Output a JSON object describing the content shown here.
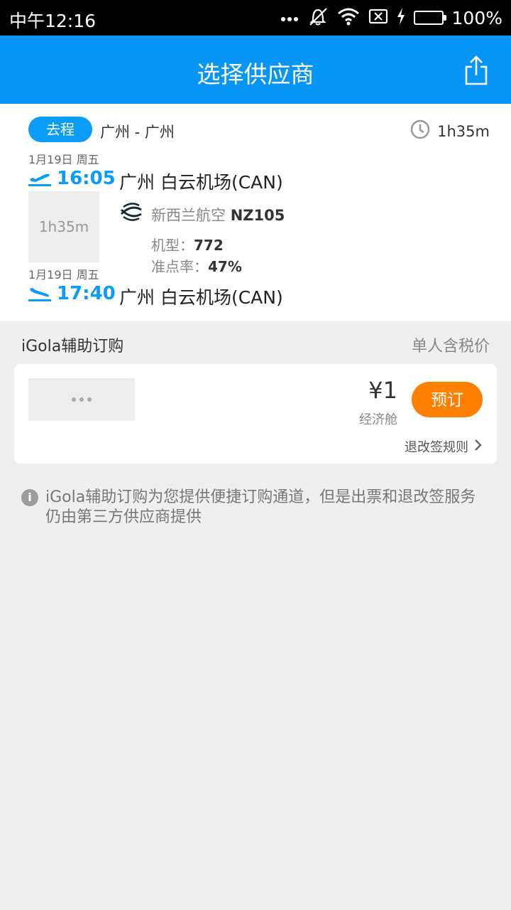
{
  "status_bar": {
    "time": "中午12:16",
    "battery_percent": "100%",
    "battery_level": 1.0,
    "icons": [
      "more-dots-icon",
      "vibrate-off-icon",
      "wifi-icon",
      "no-sim-icon",
      "charging-icon",
      "battery-icon"
    ]
  },
  "header": {
    "title": "选择供应商",
    "share_icon": "share-icon"
  },
  "flight": {
    "direction_tag": "去程",
    "route": "广州 - 广州",
    "total_duration": "1h35m",
    "departure": {
      "date": "1月19日 周五",
      "time": "16:05",
      "airport": "广州 白云机场(CAN)"
    },
    "segment_duration": "1h35m",
    "airline": {
      "name": "新西兰航空",
      "flight_no": "NZ105",
      "aircraft_label": "机型：",
      "aircraft": "772",
      "ontime_label": "准点率：",
      "ontime": "47%"
    },
    "arrival": {
      "date": "1月19日 周五",
      "time": "17:40",
      "airport": "广州 白云机场(CAN)"
    }
  },
  "supplier_section": {
    "title": "iGola辅助订购",
    "price_note": "单人含税价"
  },
  "offer": {
    "price": "¥1",
    "cabin": "经济舱",
    "book_label": "预订",
    "rules_label": "退改签规则"
  },
  "note": {
    "text": "iGola辅助订购为您提供便捷订购通道，但是出票和退改签服务仍由第三方供应商提供"
  },
  "colors": {
    "primary": "#0795f6",
    "accent_blue": "#0a9cf7",
    "book_button": "#ff8000",
    "battery": "#5fd327",
    "background": "#efefef"
  }
}
